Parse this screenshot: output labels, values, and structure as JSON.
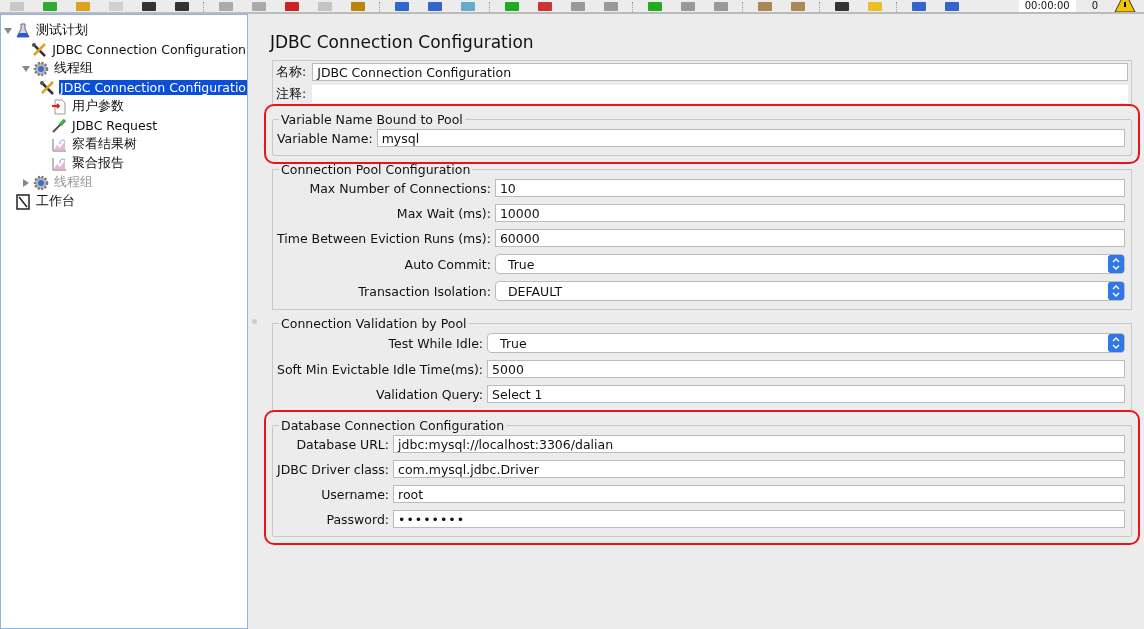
{
  "toolbar": {
    "timer": "00:00:00",
    "warning_count": "0"
  },
  "tree": [
    {
      "label": "测试计划",
      "kind": "plan",
      "expanded": true,
      "selected": false,
      "disabled": false,
      "children": [
        {
          "label": "JDBC Connection Configuration",
          "kind": "config",
          "selected": false,
          "disabled": false
        },
        {
          "label": "线程组",
          "kind": "thread-group",
          "expanded": true,
          "selected": false,
          "disabled": false,
          "children": [
            {
              "label": "JDBC Connection Configuratio",
              "kind": "config",
              "selected": true,
              "disabled": false
            },
            {
              "label": "用户参数",
              "kind": "preprocessor",
              "selected": false,
              "disabled": false
            },
            {
              "label": "JDBC Request",
              "kind": "sampler",
              "selected": false,
              "disabled": false
            },
            {
              "label": "察看结果树",
              "kind": "listener",
              "selected": false,
              "disabled": false
            },
            {
              "label": "聚合报告",
              "kind": "listener",
              "selected": false,
              "disabled": false
            }
          ]
        },
        {
          "label": "线程组",
          "kind": "thread-group",
          "expanded": false,
          "selected": false,
          "disabled": true
        }
      ]
    },
    {
      "label": "工作台",
      "kind": "workbench",
      "selected": false,
      "disabled": false
    }
  ],
  "panel": {
    "title": "JDBC Connection Configuration",
    "name_label": "名称:",
    "name_value": "JDBC Connection Configuration",
    "comment_label": "注释:",
    "sections": [
      {
        "legend": "Variable Name Bound to Pool",
        "highlighted": true,
        "fields": [
          {
            "label": "Variable Name:",
            "kind": "text",
            "value": "mysql"
          }
        ]
      },
      {
        "legend": "Connection Pool Configuration",
        "highlighted": false,
        "fields": [
          {
            "label": "Max Number of Connections:",
            "kind": "text",
            "value": "10"
          },
          {
            "label": "Max Wait (ms):",
            "kind": "text",
            "value": "10000"
          },
          {
            "label": "Time Between Eviction Runs (ms):",
            "kind": "text",
            "value": "60000"
          },
          {
            "label": "Auto Commit:",
            "kind": "select",
            "value": "True"
          },
          {
            "label": "Transaction Isolation:",
            "kind": "select",
            "value": "DEFAULT"
          }
        ]
      },
      {
        "legend": "Connection Validation by Pool",
        "highlighted": false,
        "fields": [
          {
            "label": "Test While Idle:",
            "kind": "select",
            "value": "True"
          },
          {
            "label": "Soft Min Evictable Idle Time(ms):",
            "kind": "text",
            "value": "5000"
          },
          {
            "label": "Validation Query:",
            "kind": "text",
            "value": "Select 1"
          }
        ]
      },
      {
        "legend": "Database Connection Configuration",
        "highlighted": true,
        "fields": [
          {
            "label": "Database URL:",
            "kind": "text",
            "value": "jdbc:mysql://localhost:3306/dalian"
          },
          {
            "label": "JDBC Driver class:",
            "kind": "text",
            "value": "com.mysql.jdbc.Driver"
          },
          {
            "label": "Username:",
            "kind": "text",
            "value": "root"
          },
          {
            "label": "Password:",
            "kind": "password",
            "value": "••••••••"
          }
        ]
      }
    ]
  }
}
